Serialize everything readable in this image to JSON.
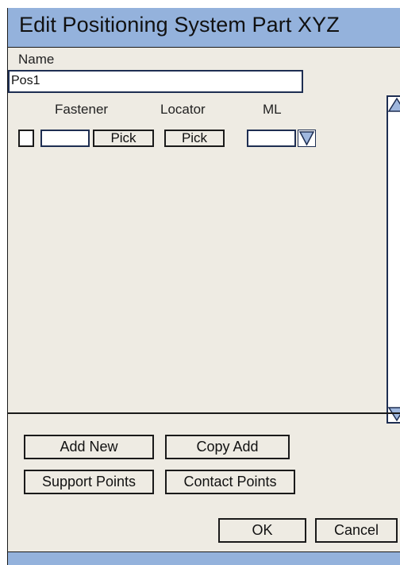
{
  "window": {
    "title": "Edit Positioning System Part XYZ"
  },
  "form": {
    "name_label": "Name",
    "name_value": "Pos1",
    "columns": {
      "fastener": "Fastener",
      "locator": "Locator",
      "ml": "ML"
    },
    "row": {
      "fastener_pick": "Pick",
      "locator_pick": "Pick"
    }
  },
  "buttons": {
    "add_new": "Add New",
    "copy_add": "Copy Add",
    "support_points": "Support Points",
    "contact_points": "Contact Points",
    "ok": "OK",
    "cancel": "Cancel"
  },
  "colors": {
    "title_bar": "#94b2dc",
    "background": "#eeebe3",
    "field_border": "#1e2e52"
  },
  "icons": {
    "ml_dropdown": "triangle-down-icon",
    "scroll_up": "triangle-up-icon",
    "scroll_down": "triangle-down-icon"
  }
}
